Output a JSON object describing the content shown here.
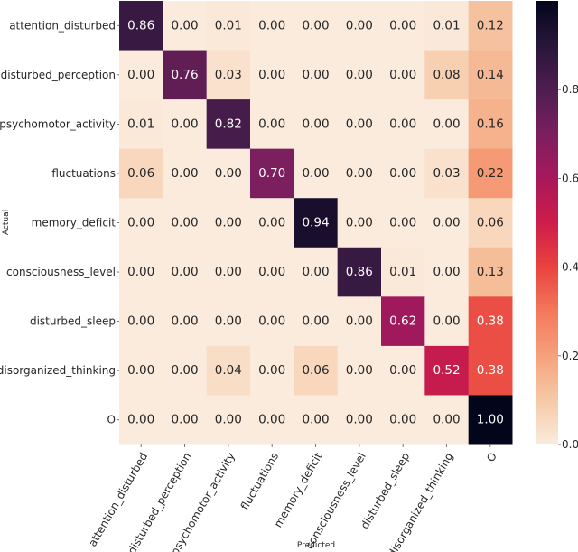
{
  "chart_data": {
    "type": "heatmap",
    "title": "",
    "xlabel": "Predicted",
    "ylabel": "Actual",
    "x_categories": [
      "attention_disturbed",
      "disturbed_perception",
      "psychomotor_activity",
      "fluctuations",
      "memory_deficit",
      "consciousness_level",
      "disturbed_sleep",
      "disorganized_thinking",
      "O"
    ],
    "y_categories": [
      "attention_disturbed",
      "disturbed_perception",
      "psychomotor_activity",
      "fluctuations",
      "memory_deficit",
      "consciousness_level",
      "disturbed_sleep",
      "disorganized_thinking",
      "O"
    ],
    "values": [
      [
        0.86,
        0.0,
        0.01,
        0.0,
        0.0,
        0.0,
        0.0,
        0.01,
        0.12
      ],
      [
        0.0,
        0.76,
        0.03,
        0.0,
        0.0,
        0.0,
        0.0,
        0.08,
        0.14
      ],
      [
        0.01,
        0.0,
        0.82,
        0.0,
        0.0,
        0.0,
        0.0,
        0.0,
        0.16
      ],
      [
        0.06,
        0.0,
        0.0,
        0.7,
        0.0,
        0.0,
        0.0,
        0.03,
        0.22
      ],
      [
        0.0,
        0.0,
        0.0,
        0.0,
        0.94,
        0.0,
        0.0,
        0.0,
        0.06
      ],
      [
        0.0,
        0.0,
        0.0,
        0.0,
        0.0,
        0.86,
        0.01,
        0.0,
        0.13
      ],
      [
        0.0,
        0.0,
        0.0,
        0.0,
        0.0,
        0.0,
        0.62,
        0.0,
        0.38
      ],
      [
        0.0,
        0.0,
        0.04,
        0.0,
        0.06,
        0.0,
        0.0,
        0.52,
        0.38
      ],
      [
        0.0,
        0.0,
        0.0,
        0.0,
        0.0,
        0.0,
        0.0,
        0.0,
        1.0
      ]
    ],
    "value_format": "0.00",
    "colormap": "rocket_r",
    "colorbar": {
      "range": [
        0.0,
        1.0
      ],
      "ticks": [
        0.0,
        0.2,
        0.4,
        0.6,
        0.8
      ],
      "tick_labels": [
        "0.0",
        "0.2",
        "0.4",
        "0.6",
        "0.8"
      ]
    },
    "colors": {
      "low": "#faebdd",
      "high": "#03051a",
      "text_dark": "#262626",
      "text_light": "#ffffff"
    }
  }
}
